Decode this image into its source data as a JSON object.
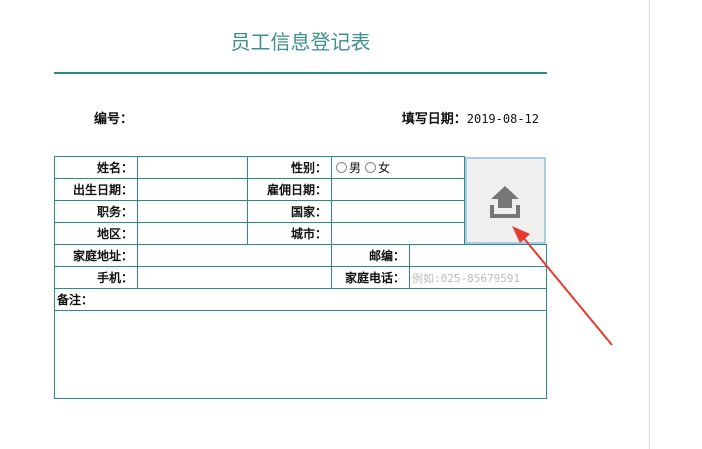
{
  "form": {
    "title": "员工信息登记表",
    "number_label": "编号：",
    "date_label": "填写日期：",
    "date_value": "2019-08-12",
    "fields": {
      "name": "姓名：",
      "gender": "性别：",
      "gender_male": "男",
      "gender_female": "女",
      "birth_date": "出生日期：",
      "hire_date": "雇佣日期：",
      "position": "职务：",
      "country": "国家：",
      "region": "地区：",
      "city": "城市：",
      "home_address": "家庭地址：",
      "postal_code": "邮编：",
      "mobile": "手机：",
      "home_phone": "家庭电话：",
      "home_phone_placeholder": "例如:025-85679591",
      "remarks": "备注："
    }
  },
  "upload": {
    "icon": "upload-icon"
  },
  "annotation": {
    "icon": "red-arrow",
    "color": "#e8392f"
  }
}
